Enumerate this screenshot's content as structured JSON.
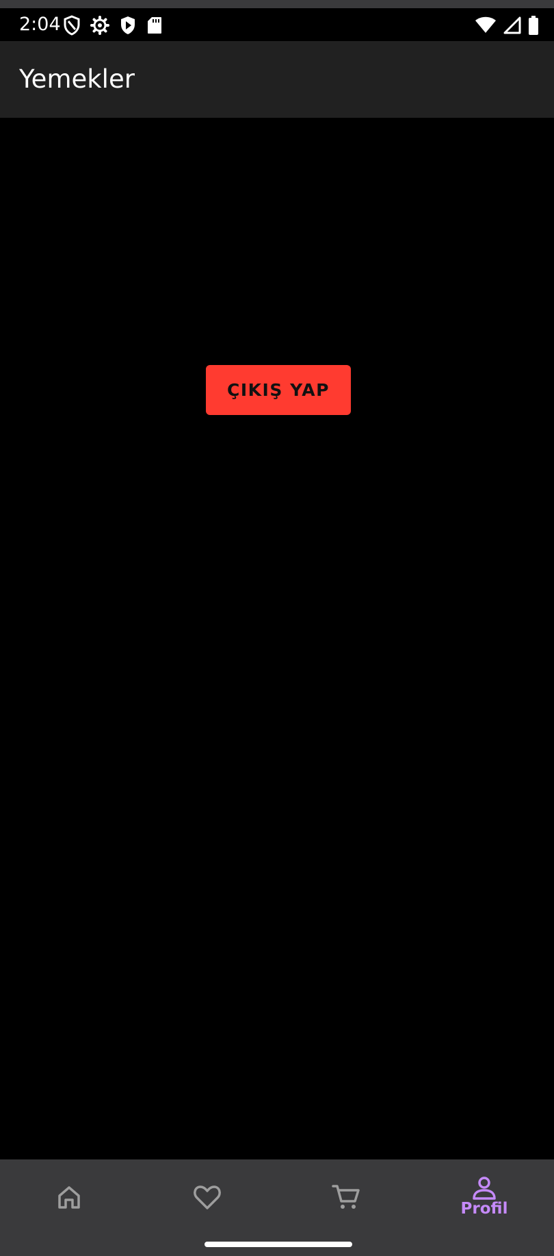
{
  "status_bar": {
    "time": "2:04",
    "left_icons": [
      "vpn-shield-icon",
      "settings-gear-icon",
      "play-protect-icon",
      "sd-card-icon"
    ],
    "right_icons": [
      "wifi-icon",
      "cellular-signal-icon",
      "battery-icon"
    ]
  },
  "app_bar": {
    "title": "Yemekler"
  },
  "main": {
    "logout_button_label": "ÇIKIŞ YAP",
    "logout_button_color": "#ff3b30"
  },
  "bottom_nav": {
    "items": [
      {
        "icon": "home-icon",
        "label": "",
        "selected": false
      },
      {
        "icon": "heart-icon",
        "label": "",
        "selected": false
      },
      {
        "icon": "cart-icon",
        "label": "",
        "selected": false
      },
      {
        "icon": "person-icon",
        "label": "Profil",
        "selected": true
      }
    ],
    "selected_color": "#c58af9",
    "unselected_color": "#9e9e9e"
  }
}
